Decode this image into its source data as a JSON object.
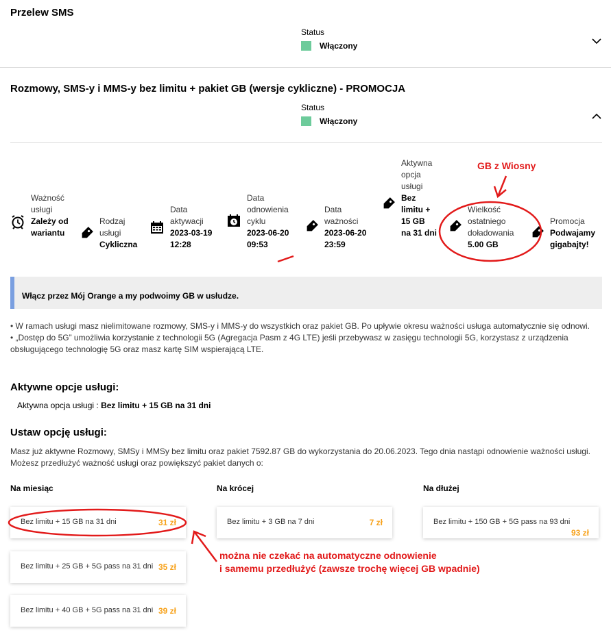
{
  "section1": {
    "title": "Przelew SMS",
    "status_label": "Status",
    "status_value": "Włączony"
  },
  "section2": {
    "title": "Rozmowy, SMS-y i MMS-y bez limitu + pakiet GB (wersje cykliczne) - PROMOCJA",
    "status_label": "Status",
    "status_value": "Włączony",
    "info": [
      {
        "label": "Ważność usługi",
        "value": "Zależy od wariantu",
        "icon": "alarm-clock-icon"
      },
      {
        "label": "Rodzaj usługi",
        "value": "Cykliczna",
        "icon": "tag-icon"
      },
      {
        "label": "Data aktywacji",
        "value": "2023-03-19 12:28",
        "icon": "calendar-icon"
      },
      {
        "label": "Data odnowienia cyklu",
        "value": "2023-06-20 09:53",
        "icon": "calendar-clock-icon"
      },
      {
        "label": "Data ważności",
        "value": "2023-06-20 23:59",
        "icon": "tag-icon"
      },
      {
        "label": "Aktywna opcja usługi",
        "value": "Bez limitu + 15 GB na 31 dni",
        "icon": "tag-icon"
      },
      {
        "label": "Wielkość ostatniego doładowania",
        "value": "5.00 GB",
        "icon": "tag-icon"
      },
      {
        "label": "Promocja",
        "value": "Podwajamy gigabajty!",
        "icon": "tag-icon"
      }
    ]
  },
  "banner": "Włącz przez Mój Orange a my podwoimy GB w usłudze.",
  "bullets": [
    "• W ramach usługi masz nielimitowane rozmowy, SMS-y i MMS-y do wszystkich oraz pakiet GB. Po upływie okresu ważności usługa automatycznie się odnowi.",
    "• „Dostęp do 5G” umożliwia korzystanie z technologii 5G (Agregacja Pasm z 4G LTE) jeśli przebywasz w zasięgu technologii 5G, korzystasz z urządzenia obsługującego technologię 5G oraz masz kartę SIM wspierającą LTE."
  ],
  "active_options": {
    "heading": "Aktywne opcje usługi:",
    "label": "Aktywna opcja usługi : ",
    "value": "Bez limitu + 15 GB na 31 dni"
  },
  "set_option": {
    "heading": "Ustaw opcję usługi:",
    "description": "Masz już aktywne Rozmowy, SMSy i MMSy bez limitu oraz pakiet 7592.87 GB do wykorzystania do 20.06.2023. Tego dnia nastąpi odnowienie ważności usługi. Możesz przedłużyć ważność usługi oraz powiększyć pakiet danych o:"
  },
  "columns": [
    {
      "heading": "Na miesiąc",
      "offers": [
        {
          "label": "Bez limitu + 15 GB na 31 dni",
          "price": "31 zł"
        },
        {
          "label": "Bez limitu + 25 GB + 5G pass na 31 dni",
          "price": "35 zł"
        },
        {
          "label": "Bez limitu + 40 GB + 5G pass na 31 dni",
          "price": "39 zł"
        }
      ]
    },
    {
      "heading": "Na krócej",
      "offers": [
        {
          "label": "Bez limitu + 3 GB na 7 dni",
          "price": "7 zł"
        }
      ]
    },
    {
      "heading": "Na dłużej",
      "offers": [
        {
          "label": "Bez limitu + 150 GB + 5G pass na 93 dni",
          "price": "93 zł"
        }
      ]
    }
  ],
  "annotations": {
    "gb_label": "GB z Wiosny",
    "note_line1": "można nie czekać na automatyczne odnowienie",
    "note_line2": "i samemu przedłużyć (zawsze trochę więcej GB wpadnie)"
  },
  "colors": {
    "status_green": "#6dcb9b",
    "price_orange": "#f7a21b",
    "banner_accent": "#7a9fe0",
    "annotation_red": "#e21a1a"
  }
}
